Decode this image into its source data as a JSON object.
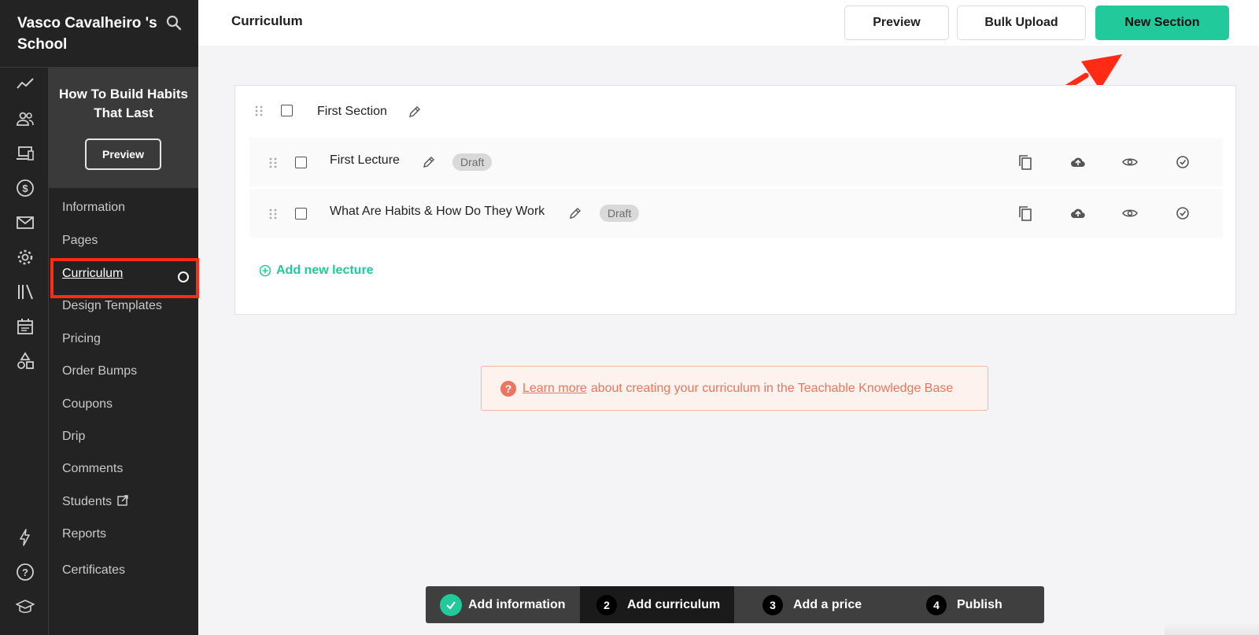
{
  "school": {
    "name": "Vasco Cavalheiro 's School"
  },
  "course": {
    "title": "How To Build Habits That Last",
    "preview_label": "Preview"
  },
  "course_nav": [
    {
      "label": "Information"
    },
    {
      "label": "Pages"
    },
    {
      "label": "Curriculum",
      "active": true
    },
    {
      "label": "Design Templates"
    },
    {
      "label": "Pricing"
    },
    {
      "label": "Order Bumps"
    },
    {
      "label": "Coupons"
    },
    {
      "label": "Drip"
    },
    {
      "label": "Comments"
    },
    {
      "label": "Students",
      "external": true
    },
    {
      "label": "Reports"
    },
    {
      "label": "Certificates"
    }
  ],
  "rail_icons": [
    "trend-icon",
    "users-icon",
    "devices-icon",
    "dollar-icon",
    "mail-icon",
    "gear-icon",
    "library-icon",
    "calendar-icon",
    "shapes-icon",
    "bolt-icon",
    "help-icon",
    "graduation-icon"
  ],
  "header": {
    "title": "Curriculum",
    "preview_label": "Preview",
    "bulk_upload_label": "Bulk Upload",
    "new_section_label": "New Section"
  },
  "curriculum": {
    "section_title": "First Section",
    "lectures": [
      {
        "title": "First Lecture",
        "status": "Draft"
      },
      {
        "title": "What Are Habits & How Do They Work",
        "status": "Draft"
      }
    ],
    "add_lecture_label": "Add new lecture"
  },
  "help": {
    "link_text": "Learn more",
    "text": "about creating your curriculum in the Teachable Knowledge Base"
  },
  "stepper": [
    {
      "number": "",
      "label": "Add information",
      "done": true
    },
    {
      "number": "2",
      "label": "Add curriculum",
      "current": true
    },
    {
      "number": "3",
      "label": "Add a price"
    },
    {
      "number": "4",
      "label": "Publish"
    }
  ],
  "colors": {
    "accent": "#22c99b",
    "highlight": "#ff2b14",
    "sidebar": "#232323",
    "help": "#e87660"
  }
}
